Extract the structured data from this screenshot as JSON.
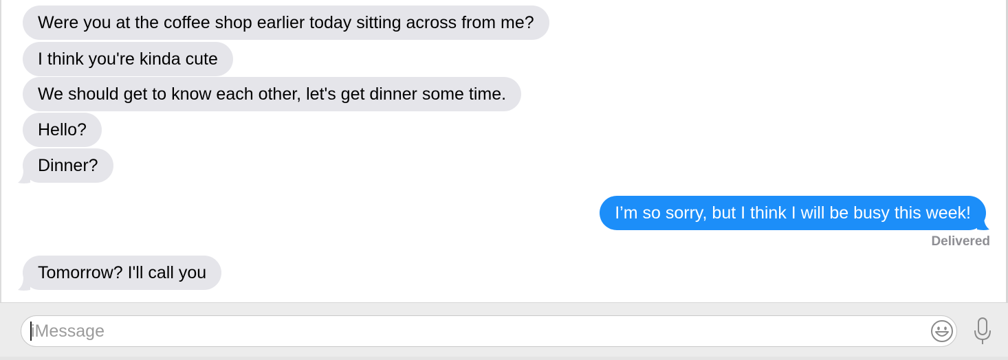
{
  "conversation": {
    "messages": [
      {
        "direction": "incoming",
        "text": "Were you at the coffee shop earlier today sitting across from me?"
      },
      {
        "direction": "incoming",
        "text": "I think you're kinda cute"
      },
      {
        "direction": "incoming",
        "text": "We should get to know each other, let's get dinner some time."
      },
      {
        "direction": "incoming",
        "text": "Hello?"
      },
      {
        "direction": "incoming",
        "text": "Dinner?"
      },
      {
        "direction": "outgoing",
        "text": "I’m so sorry, but I think I will be busy this week!"
      },
      {
        "direction": "incoming",
        "text": "Tomorrow? I'll call you"
      }
    ],
    "delivery_status": "Delivered"
  },
  "composer": {
    "placeholder": "iMessage",
    "value": ""
  },
  "icons": {
    "emoji": "emoji-smiley-icon",
    "microphone": "microphone-icon"
  },
  "colors": {
    "incoming_bubble": "#e5e5ea",
    "outgoing_bubble": "#1c8ef9",
    "status_text": "#8e8e93"
  }
}
